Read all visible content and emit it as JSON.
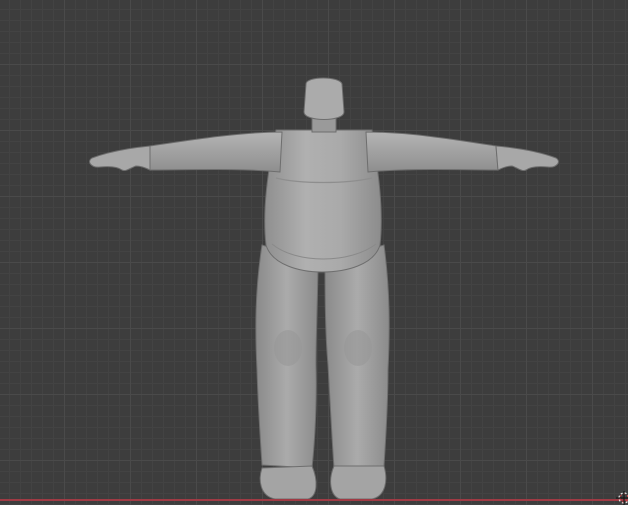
{
  "viewport": {
    "grid_visible": true,
    "shading": "solid",
    "background_color": "#3d3d3d",
    "mesh_color": "#a9a9a9",
    "x_axis_color": "#a03a44"
  },
  "object": {
    "type": "humanoid-mesh",
    "pose": "T-pose"
  },
  "icons": {
    "origin_cursor": "3d-cursor-icon"
  }
}
